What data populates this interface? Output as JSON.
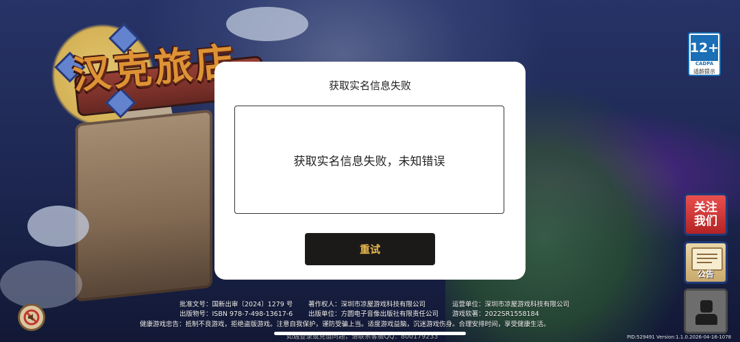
{
  "game": {
    "logo_text": "汉克旅店",
    "age_rating": {
      "number": "12+",
      "org": "CADPA",
      "tip": "适龄提示"
    }
  },
  "dialog": {
    "title": "获取实名信息失败",
    "message": "获取实名信息失败，未知错误",
    "retry_label": "重试"
  },
  "side_buttons": {
    "follow_label": "关注我们",
    "notice_label": "公告"
  },
  "footer": {
    "approval": "批准文号：国新出审〔2024〕1279 号",
    "copyright_owner": "著作权人：深圳市凉屋游戏科技有限公司",
    "operator": "运营单位：深圳市凉屋游戏科技有限公司",
    "isbn": "出版物号：ISBN 978-7-498-13617-6",
    "publisher": "出版单位：方圆电子音像出版社有限责任公司",
    "software_reg": "游戏软著：2022SR1558184",
    "health_notice": "健康游戏忠告：抵制不良游戏，拒绝盗版游戏。注意自我保护，谨防受骗上当。适度游戏益脑，沉迷游戏伤身。合理安排时间，享受健康生活。",
    "contact": "如遇登录或充值问题，请联系客服QQ：800179233",
    "version": "PID:529491  Version:1.1.0.2026-04-16-1078"
  },
  "icons": {
    "sound": "sound-muted-icon",
    "notice": "scroll-icon",
    "account": "avatar-icon"
  }
}
